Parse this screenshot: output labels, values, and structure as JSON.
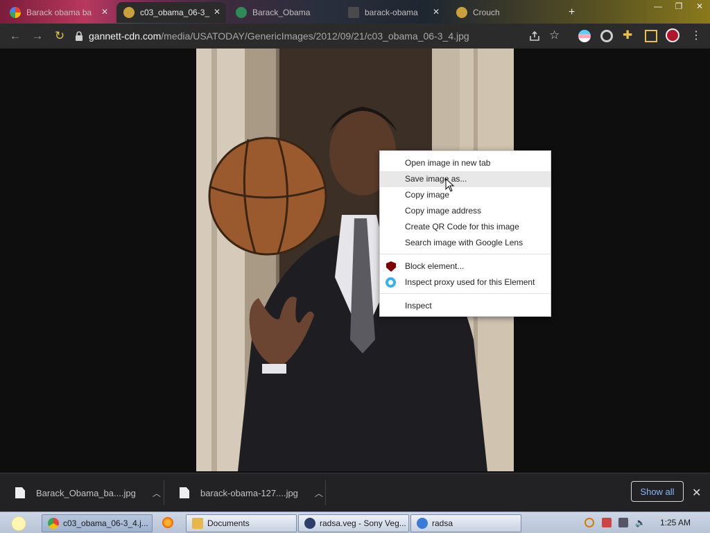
{
  "browser": {
    "tabs": [
      {
        "title": "Barack obama ba",
        "active": false
      },
      {
        "title": "c03_obama_06-3_",
        "active": true
      },
      {
        "title": "Barack_Obama",
        "active": false
      },
      {
        "title": "barack-obama",
        "active": false
      },
      {
        "title": "Crouch",
        "active": false
      }
    ],
    "window_controls": {
      "minimize": "—",
      "maximize": "❐",
      "close": "✕"
    },
    "url_domain": "gannett-cdn.com",
    "url_path": "/media/USATODAY/GenericImages/2012/09/21/c03_obama_06-3_4.jpg"
  },
  "context_menu": {
    "items": [
      {
        "label": "Open image in new tab",
        "hover": false
      },
      {
        "label": "Save image as...",
        "hover": true
      },
      {
        "label": "Copy image",
        "hover": false
      },
      {
        "label": "Copy image address",
        "hover": false
      },
      {
        "label": "Create QR Code for this image",
        "hover": false
      },
      {
        "label": "Search image with Google Lens",
        "hover": false
      },
      {
        "label": "Block element...",
        "hover": false
      },
      {
        "label": "Inspect proxy used for this Element",
        "hover": false
      },
      {
        "label": "Inspect",
        "hover": false
      }
    ]
  },
  "downloads": {
    "items": [
      {
        "name": "Barack_Obama_ba....jpg"
      },
      {
        "name": "barack-obama-127....jpg"
      }
    ],
    "show_all": "Show all",
    "close": "✕"
  },
  "taskbar": {
    "buttons": [
      {
        "label": "c03_obama_06-3_4.j..."
      },
      {
        "label": "Documents"
      },
      {
        "label": "radsa.veg - Sony Veg..."
      },
      {
        "label": "radsa"
      }
    ],
    "clock": "1:25 AM"
  },
  "colors": {
    "accent_link": "#8ab4f8",
    "ublock_red": "#800000",
    "proxy_blue": "#3ab0f0"
  }
}
